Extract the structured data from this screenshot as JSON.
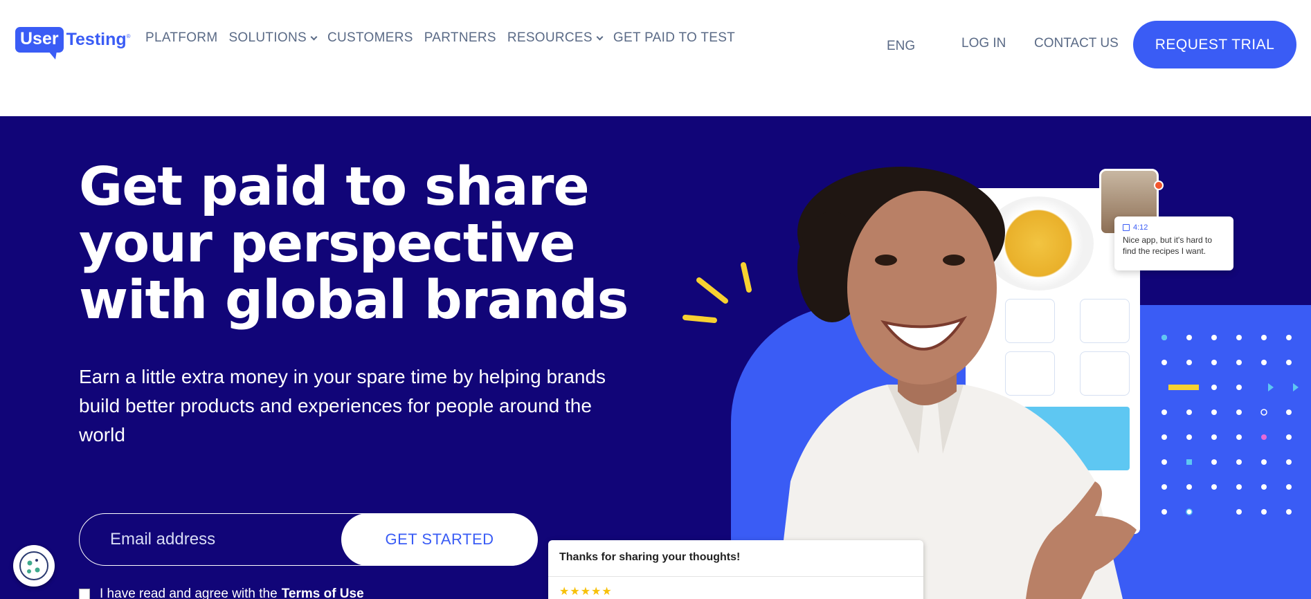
{
  "header": {
    "logo": {
      "left": "User",
      "right": "Testing",
      "tm": "®"
    },
    "nav": [
      {
        "label": "PLATFORM",
        "dropdown": false
      },
      {
        "label": "SOLUTIONS",
        "dropdown": true
      },
      {
        "label": "CUSTOMERS",
        "dropdown": false
      },
      {
        "label": "PARTNERS",
        "dropdown": false
      },
      {
        "label": "RESOURCES",
        "dropdown": true
      },
      {
        "label": "GET PAID TO TEST",
        "dropdown": false
      }
    ],
    "language": "ENG",
    "login": "LOG IN",
    "contact": "CONTACT US",
    "cta": "REQUEST TRIAL"
  },
  "hero": {
    "headline": [
      "Get paid to share",
      "your perspective",
      "with global brands"
    ],
    "subtext": "Earn a little extra money in your spare time by helping brands build better products and experiences for people around the world",
    "email_placeholder": "Email address",
    "get_started": "GET STARTED",
    "terms_prefix": "I have read and agree with the",
    "terms_link": "Terms of Use",
    "comment": {
      "time": "4:12",
      "text": "Nice app, but it's hard to find the recipes I want."
    },
    "rating_card_title": "Thanks for sharing your thoughts!",
    "rating_stars": "★★★★★"
  },
  "colors": {
    "brand_blue": "#3a5cf5",
    "hero_bg": "#110578",
    "accent_yellow": "#f7d131"
  }
}
